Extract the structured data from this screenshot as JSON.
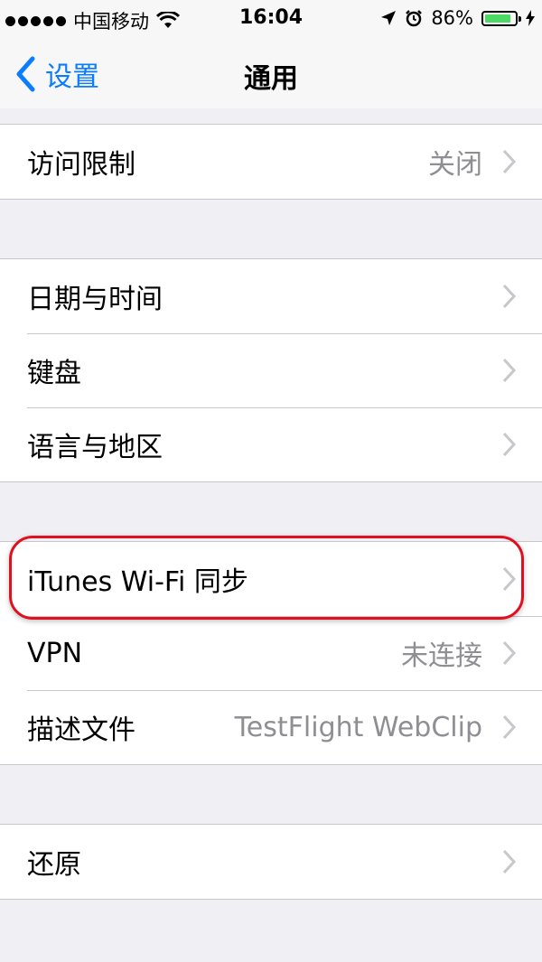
{
  "status_bar": {
    "carrier": "中国移动",
    "time": "16:04",
    "battery_percent_text": "86%",
    "battery_level": 0.86,
    "icons": [
      "signal-dots-icon",
      "wifi-icon",
      "location-arrow-icon",
      "alarm-icon",
      "battery-icon",
      "charging-bolt-icon"
    ]
  },
  "navbar": {
    "back_label": "设置",
    "title": "通用"
  },
  "groups": [
    [
      {
        "label": "访问限制",
        "value": "关闭"
      }
    ],
    [
      {
        "label": "日期与时间",
        "value": ""
      },
      {
        "label": "键盘",
        "value": ""
      },
      {
        "label": "语言与地区",
        "value": ""
      }
    ],
    [
      {
        "label": "iTunes Wi-Fi 同步",
        "value": ""
      },
      {
        "label": "VPN",
        "value": "未连接"
      },
      {
        "label": "描述文件",
        "value": "TestFlight WebClip"
      }
    ],
    [
      {
        "label": "还原",
        "value": ""
      }
    ]
  ],
  "colors": {
    "accent": "#0a7cff",
    "highlight": "#e0101f",
    "background": "#efeff4",
    "secondary_text": "#8e8e93"
  }
}
